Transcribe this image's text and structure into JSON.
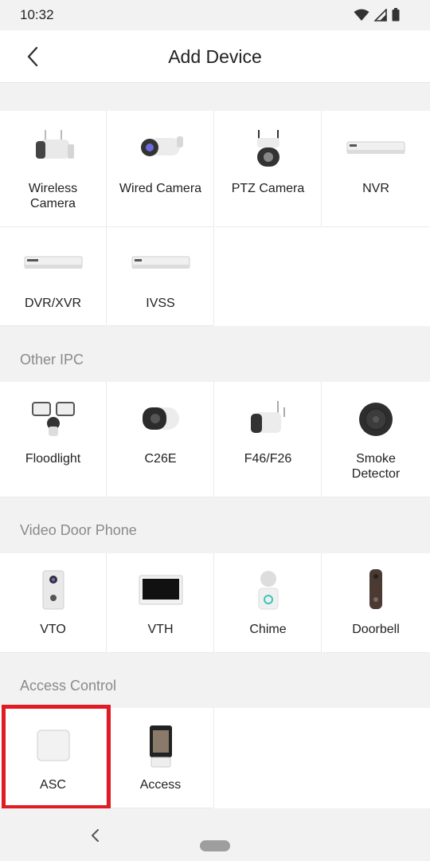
{
  "status_bar": {
    "time": "10:32"
  },
  "header": {
    "title": "Add Device"
  },
  "sections": [
    {
      "title": ""
    },
    {
      "title": "Other IPC"
    },
    {
      "title": "Video Door Phone"
    },
    {
      "title": "Access Control"
    }
  ],
  "devices": {
    "main": [
      {
        "label": "Wireless\nCamera",
        "icon": "wireless-camera-icon"
      },
      {
        "label": "Wired Camera",
        "icon": "wired-camera-icon"
      },
      {
        "label": "PTZ Camera",
        "icon": "ptz-camera-icon"
      },
      {
        "label": "NVR",
        "icon": "nvr-icon"
      },
      {
        "label": "DVR/XVR",
        "icon": "dvr-icon"
      },
      {
        "label": "IVSS",
        "icon": "ivss-icon"
      }
    ],
    "other_ipc": [
      {
        "label": "Floodlight",
        "icon": "floodlight-icon"
      },
      {
        "label": "C26E",
        "icon": "c26e-icon"
      },
      {
        "label": "F46/F26",
        "icon": "f46-camera-icon"
      },
      {
        "label": "Smoke\nDetector",
        "icon": "smoke-detector-icon"
      }
    ],
    "door_phone": [
      {
        "label": "VTO",
        "icon": "vto-icon"
      },
      {
        "label": "VTH",
        "icon": "vth-icon"
      },
      {
        "label": "Chime",
        "icon": "chime-icon"
      },
      {
        "label": "Doorbell",
        "icon": "doorbell-icon"
      }
    ],
    "access_control": [
      {
        "label": "ASC",
        "icon": "asc-icon"
      },
      {
        "label": "Access",
        "icon": "access-icon"
      }
    ]
  },
  "colors": {
    "highlight": "#e01b24",
    "section_text": "#8a8a8a"
  }
}
